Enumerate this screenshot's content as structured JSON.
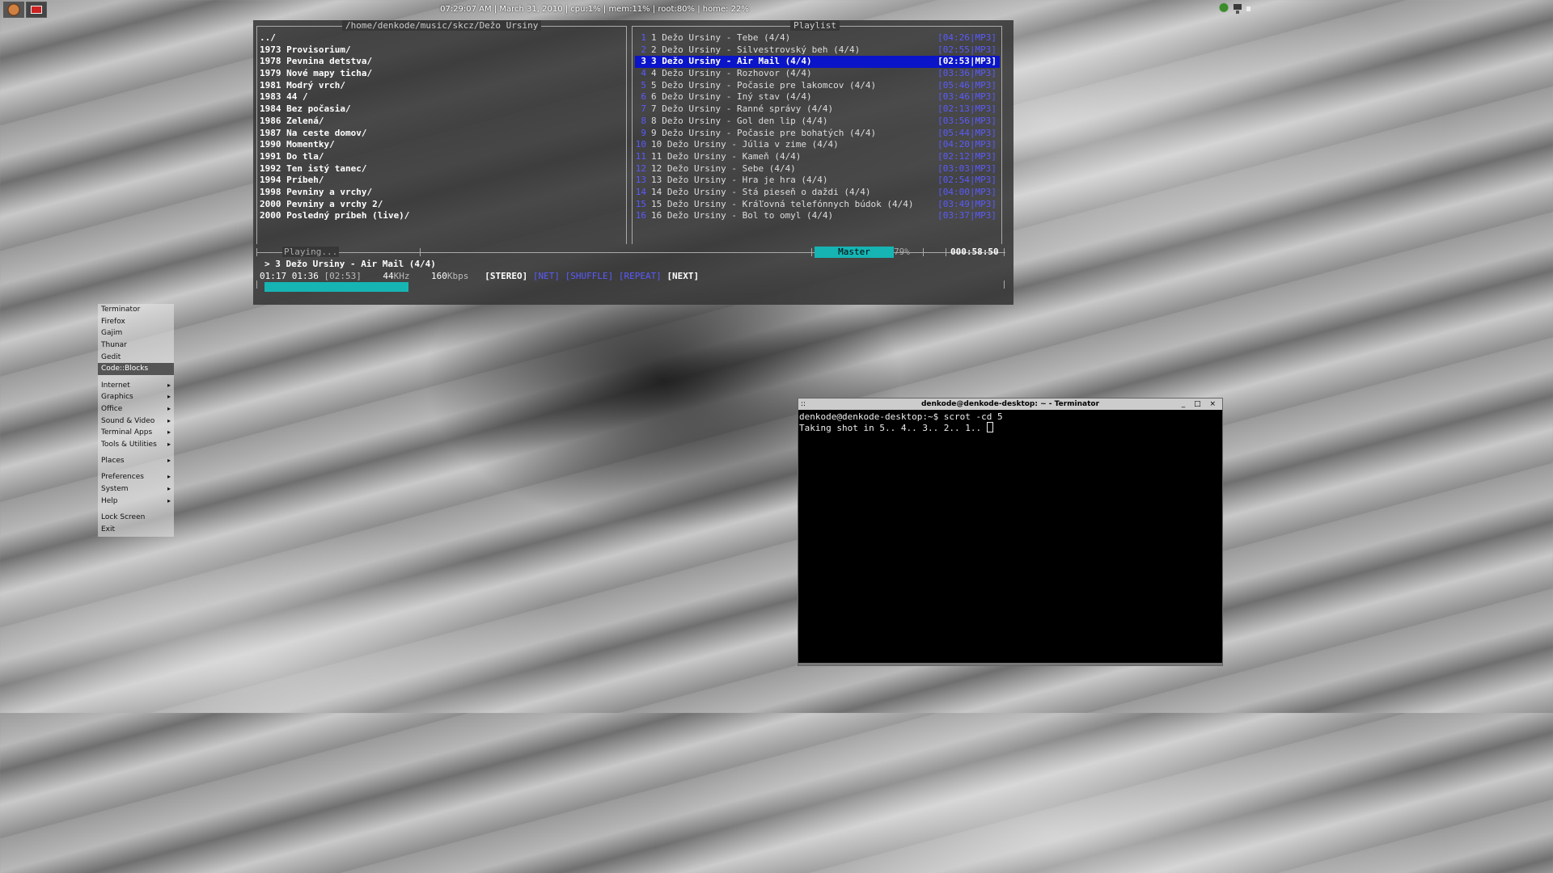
{
  "status_bar": {
    "text": "07:29:07 AM | March 31, 2010 | cpu:1% | mem:11% | root:80% | home: 22%"
  },
  "taskbar": {
    "icons": [
      "firefox-icon",
      "terminal-icon"
    ]
  },
  "tray": {
    "icons": [
      "network-icon",
      "app-icon",
      "volume-icon"
    ]
  },
  "player": {
    "path_title": "/home/denkode/music/skcz/Dežo Ursiny",
    "playlist_title": "Playlist",
    "directories": [
      "../",
      "1973 Provisorium/",
      "1978 Pevnina detstva/",
      "1979 Nové mapy ticha/",
      "1981 Modrý vrch/",
      "1983 44 /",
      "1984 Bez počasia/",
      "1986 Zelená/",
      "1987 Na ceste domov/",
      "1990 Momentky/",
      "1991 Do tla/",
      "1992 Ten istý tanec/",
      "1994 Príbeh/",
      "1998 Pevniny a vrchy/",
      "2000 Pevniny a vrchy 2/",
      "2000 Posledný príbeh (live)/"
    ],
    "playlist": [
      {
        "num": "1",
        "title": "1 Dežo Ursiny - Tebe (4/4)",
        "time": "[04:26|MP3]"
      },
      {
        "num": "2",
        "title": "2 Dežo Ursiny - Silvestrovský beh (4/4)",
        "time": "[02:55|MP3]"
      },
      {
        "num": "3",
        "title": "3 Dežo Ursiny - Air Mail (4/4)",
        "time": "[02:53|MP3]"
      },
      {
        "num": "4",
        "title": "4 Dežo Ursiny - Rozhovor (4/4)",
        "time": "[03:36|MP3]"
      },
      {
        "num": "5",
        "title": "5 Dežo Ursiny - Počasie pre lakomcov (4/4)",
        "time": "[05:46|MP3]"
      },
      {
        "num": "6",
        "title": "6 Dežo Ursiny - Iný stav (4/4)",
        "time": "[03:46|MP3]"
      },
      {
        "num": "7",
        "title": "7 Dežo Ursiny - Ranné správy (4/4)",
        "time": "[02:13|MP3]"
      },
      {
        "num": "8",
        "title": "8 Dežo Ursiny - Gol den lip (4/4)",
        "time": "[03:56|MP3]"
      },
      {
        "num": "9",
        "title": "9 Dežo Ursiny - Počasie pre bohatých (4/4)",
        "time": "[05:44|MP3]"
      },
      {
        "num": "10",
        "title": "10 Dežo Ursiny - Júlia v zime (4/4)",
        "time": "[04:20|MP3]"
      },
      {
        "num": "11",
        "title": "11 Dežo Ursiny - Kameň (4/4)",
        "time": "[02:12|MP3]"
      },
      {
        "num": "12",
        "title": "12 Dežo Ursiny - Sebe (4/4)",
        "time": "[03:03|MP3]"
      },
      {
        "num": "13",
        "title": "13 Dežo Ursiny - Hra je hra (4/4)",
        "time": "[02:54|MP3]"
      },
      {
        "num": "14",
        "title": "14 Dežo Ursiny - Stá pieseň o daždi (4/4)",
        "time": "[04:00|MP3]"
      },
      {
        "num": "15",
        "title": "15 Dežo Ursiny - Kráľovná telefónnych búdok (4/4)",
        "time": "[03:49|MP3]"
      },
      {
        "num": "16",
        "title": "16 Dežo Ursiny - Bol to omyl (4/4)",
        "time": "[03:37|MP3]"
      }
    ],
    "current_index": 2,
    "status_label": "Playing...",
    "mixer_label": "Master",
    "volume": "79%",
    "volume_level": 0.79,
    "total_time": "000:58:50",
    "now_playing": "> 3 Dežo Ursiny - Air Mail (4/4)",
    "elapsed": "01:17",
    "remaining": "01:36",
    "duration": "[02:53]",
    "samplerate": "44",
    "samplerate_unit": "KHz",
    "bitrate": "160",
    "bitrate_unit": "Kbps",
    "flag_stereo": "[STEREO]",
    "flag_net": "[NET]",
    "flag_shuffle": "[SHUFFLE]",
    "flag_repeat": "[REPEAT]",
    "flag_next": "[NEXT]",
    "progress": 0.445
  },
  "menu": {
    "groups": [
      [
        {
          "label": "Terminator",
          "submenu": false
        },
        {
          "label": "Firefox",
          "submenu": false
        },
        {
          "label": "Gajim",
          "submenu": false
        },
        {
          "label": "Thunar",
          "submenu": false
        },
        {
          "label": "Gedit",
          "submenu": false
        },
        {
          "label": "Code::Blocks",
          "submenu": false,
          "selected": true
        }
      ],
      [
        {
          "label": "Internet",
          "submenu": true
        },
        {
          "label": "Graphics",
          "submenu": true
        },
        {
          "label": "Office",
          "submenu": true
        },
        {
          "label": "Sound & Video",
          "submenu": true
        },
        {
          "label": "Terminal Apps",
          "submenu": true
        },
        {
          "label": "Tools & Utilities",
          "submenu": true
        }
      ],
      [
        {
          "label": "Places",
          "submenu": true
        }
      ],
      [
        {
          "label": "Preferences",
          "submenu": true
        },
        {
          "label": "System",
          "submenu": true
        },
        {
          "label": "Help",
          "submenu": true
        }
      ],
      [
        {
          "label": "Lock Screen",
          "submenu": false
        },
        {
          "label": "Exit",
          "submenu": false
        }
      ]
    ],
    "submenu_arrow": "▸"
  },
  "terminal": {
    "title": "denkode@denkode-desktop: ~ - Terminator",
    "grip": "::",
    "controls": "_ □ ×",
    "lines": [
      "denkode@denkode-desktop:~$ scrot -cd 5",
      "Taking shot in 5.. 4.. 3.. 2.. 1.. "
    ]
  },
  "colors": {
    "accent_cyan": "#17b4b4",
    "selection_blue": "#0a14c8",
    "text_blue": "#5a5aff"
  }
}
